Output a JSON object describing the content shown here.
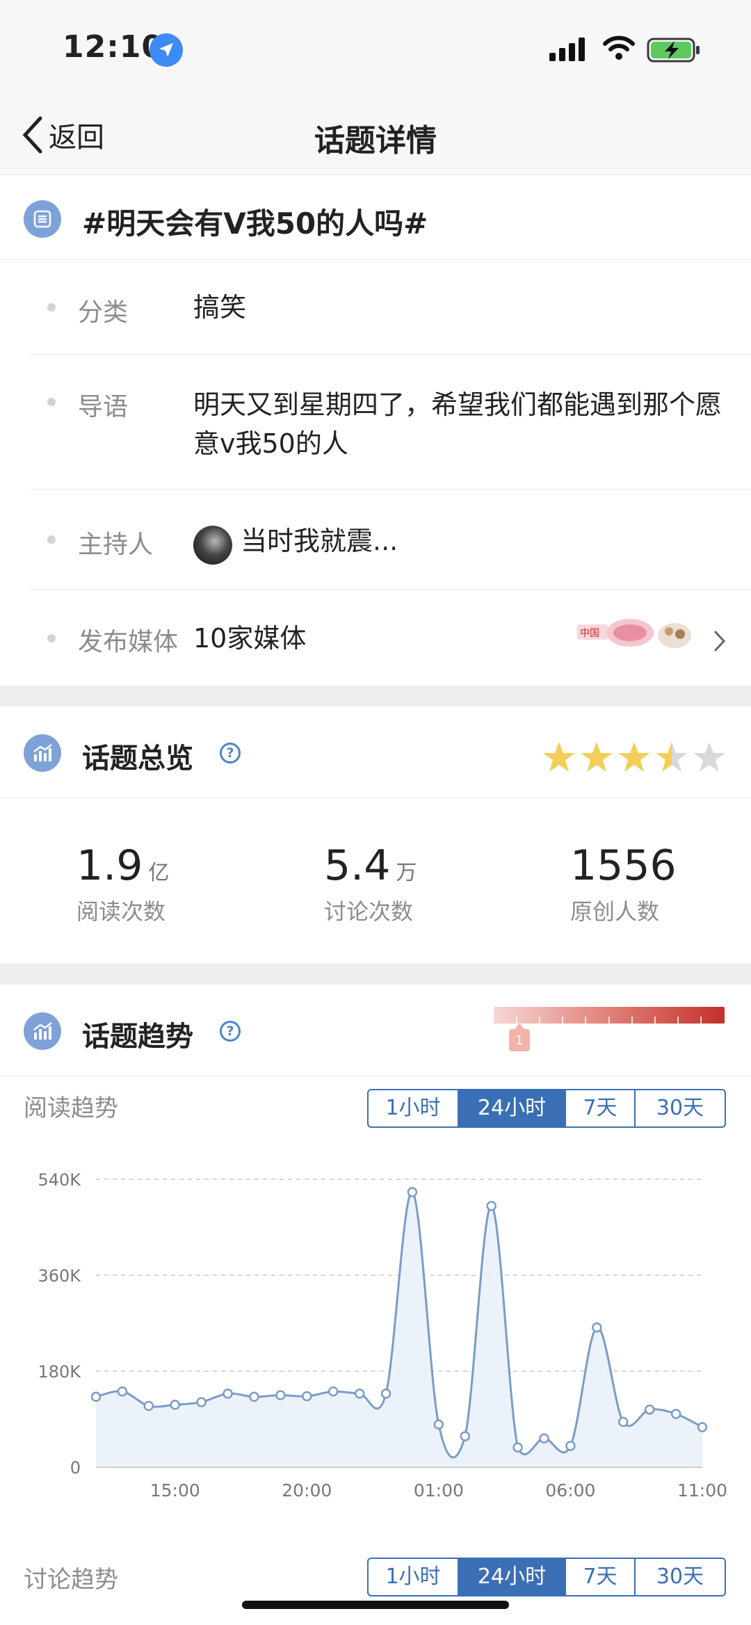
{
  "status_bar": {
    "time": "12:10"
  },
  "nav": {
    "back_label": "返回",
    "title": "话题详情"
  },
  "topic": {
    "title": "#明天会有V我50的人吗#"
  },
  "info": {
    "category_label": "分类",
    "category_value": "搞笑",
    "intro_label": "导语",
    "intro_value": "明天又到星期四了，希望我们都能遇到那个愿意v我50的人",
    "host_label": "主持人",
    "host_value": "当时我就震...",
    "media_label": "发布媒体",
    "media_value": "10家媒体"
  },
  "overview": {
    "title": "话题总览",
    "rating_stars": 3.5,
    "stats": [
      {
        "value": "1.9",
        "unit": "亿",
        "label": "阅读次数"
      },
      {
        "value": "5.4",
        "unit": "万",
        "label": "讨论次数"
      },
      {
        "value": "1556",
        "unit": "",
        "label": "原创人数"
      }
    ]
  },
  "trend": {
    "title": "话题趋势",
    "heat_marker": "1",
    "read_trend_label": "阅读趋势",
    "discuss_trend_label": "讨论趋势",
    "ranges": [
      "1小时",
      "24小时",
      "7天",
      "30天"
    ],
    "active_range": "24小时"
  },
  "colors": {
    "accent": "#3b6fb5",
    "line": "#7a9cc6",
    "fill": "#e6eef8",
    "star": "#f2cf59",
    "star_empty": "#d9d9d9"
  },
  "chart_data": {
    "type": "area",
    "title": "",
    "xlabel": "",
    "ylabel": "",
    "ylim": [
      0,
      540000
    ],
    "y_ticks": [
      "0",
      "180K",
      "360K",
      "540K"
    ],
    "x_tick_labels": [
      "15:00",
      "20:00",
      "01:00",
      "06:00",
      "11:00"
    ],
    "x": [
      "12:00",
      "13:00",
      "14:00",
      "15:00",
      "16:00",
      "17:00",
      "18:00",
      "19:00",
      "20:00",
      "21:00",
      "22:00",
      "23:00",
      "00:00",
      "01:00",
      "02:00",
      "03:00",
      "04:00",
      "05:00",
      "06:00",
      "07:00",
      "08:00",
      "09:00",
      "10:00",
      "11:00"
    ],
    "series": [
      {
        "values": [
          132000,
          142000,
          115000,
          117000,
          122000,
          138000,
          132000,
          135000,
          133000,
          142000,
          138000,
          138000,
          516000,
          80000,
          58000,
          490000,
          37000,
          54000,
          40000,
          262000,
          85000,
          108000,
          100000,
          75000
        ]
      }
    ],
    "grid": true
  }
}
